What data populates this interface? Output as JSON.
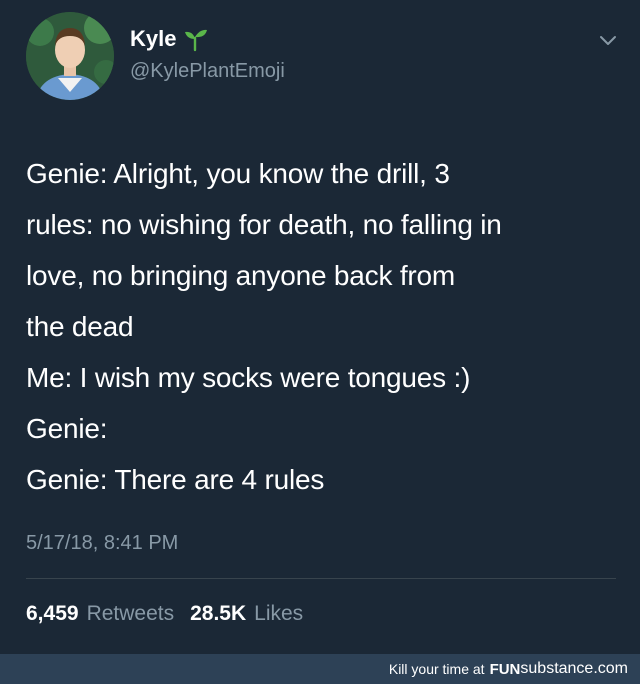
{
  "author": {
    "display_name": "Kyle",
    "handle": "@KylePlantEmoji",
    "name_emoji_icon": "sprout-icon"
  },
  "tweet": {
    "lines": [
      "Genie: Alright, you know the drill, 3",
      "rules: no wishing for death, no falling in",
      "love, no bringing anyone back from",
      "the dead",
      "Me: I wish my socks were tongues :)",
      "Genie:",
      "Genie: There are 4 rules"
    ],
    "timestamp": "5/17/18, 8:41 PM"
  },
  "stats": {
    "retweets_count": "6,459",
    "retweets_label": "Retweets",
    "likes_count": "28.5K",
    "likes_label": "Likes"
  },
  "watermark": {
    "prefix": "Kill your time at",
    "brand_fun": "FUN",
    "brand_rest": "substance.com"
  },
  "colors": {
    "background": "#1b2836",
    "secondary_text": "#8899a6",
    "divider": "#38444d"
  }
}
